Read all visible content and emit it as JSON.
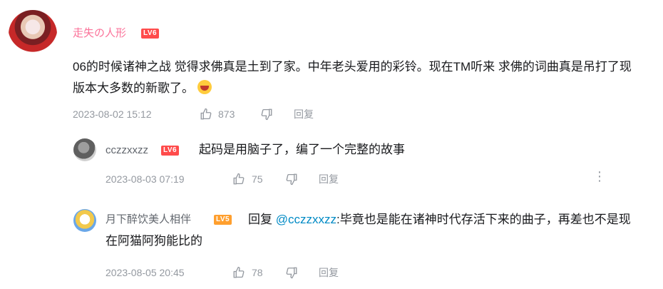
{
  "comments": [
    {
      "username": "走失の人形",
      "level": "LV6",
      "text": "06的时候诸神之战 觉得求佛真是土到了家。中年老头爱用的彩铃。现在TM听来  求佛的词曲真是吊打了现版本大多数的新歌了。",
      "emoji_icon": "laugh-cry-emoji-icon",
      "date": "2023-08-02 15:12",
      "likes": "873",
      "reply_label": "回复"
    },
    {
      "username": "cczzxxzz",
      "level": "LV6",
      "text": "起码是用脑子了，编了一个完整的故事",
      "date": "2023-08-03 07:19",
      "likes": "75",
      "reply_label": "回复",
      "more_icon": "more-vertical-icon"
    },
    {
      "username": "月下醉饮美人相伴",
      "level": "LV5",
      "reply_prefix": "回复",
      "mention": "@cczzxxzz",
      "text": ":毕竟也是能在诸神时代存活下来的曲子，再差也不是现在阿猫阿狗能比的",
      "date": "2023-08-05 20:45",
      "likes": "78",
      "reply_label": "回复"
    }
  ],
  "colors": {
    "username_vip": "#fb7299",
    "username": "#61666d",
    "meta": "#9499a0",
    "mention": "#008ac5",
    "lv6": "#ff4b4b",
    "lv5": "#ff9f2e"
  }
}
